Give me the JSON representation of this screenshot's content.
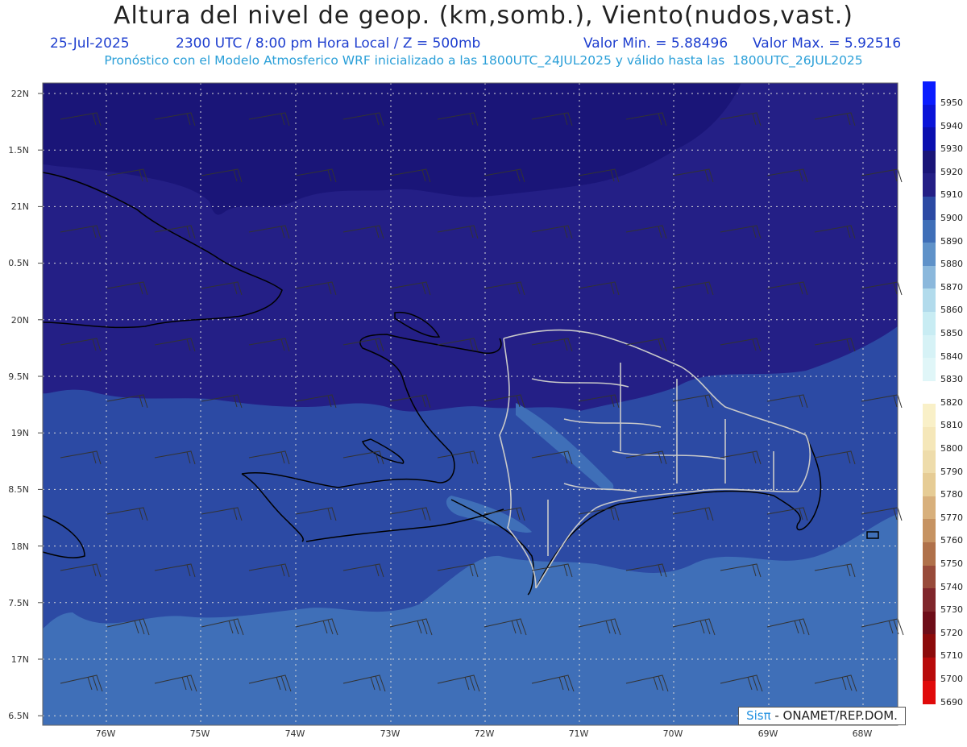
{
  "header": {
    "title": "Altura del nivel de geop. (km,somb.), Viento(nudos,vast.)",
    "date": "25-Jul-2025",
    "time_info": "2300 UTC / 8:00 pm Hora Local / Z = 500mb",
    "min_value": "Valor Min. = 5.88496",
    "max_value": "Valor Max. = 5.92516",
    "model_info": "Pronóstico con el Modelo Atmosferico WRF inicializado a las 1800UTC_24JUL2025 y válido hasta las  1800UTC_26JUL2025"
  },
  "axes": {
    "lat_labels": [
      "22N",
      "1.5N",
      "21N",
      "0.5N",
      "20N",
      "9.5N",
      "19N",
      "8.5N",
      "18N",
      "7.5N",
      "17N",
      "6.5N"
    ],
    "lon_labels": [
      "76W",
      "75W",
      "74W",
      "73W",
      "72W",
      "71W",
      "70W",
      "69W",
      "68W"
    ]
  },
  "legend": {
    "levels": [
      "5950",
      "5940",
      "5930",
      "5920",
      "5910",
      "5900",
      "5890",
      "5880",
      "5870",
      "5860",
      "5850",
      "5840",
      "5830",
      "5820",
      "5810",
      "5800",
      "5790",
      "5780",
      "5770",
      "5760",
      "5750",
      "5740",
      "5730",
      "5720",
      "5710",
      "5700",
      "5690"
    ],
    "colors": [
      "#0a1cff",
      "#0a14d8",
      "#0a0fb0",
      "#1a1578",
      "#241f86",
      "#2c4aa4",
      "#3f6fb8",
      "#5f92c9",
      "#8bb8dc",
      "#b2dbec",
      "#c8ecf3",
      "#d6f2f6",
      "#e0f6f8",
      "#ffffff",
      "#f9f0c8",
      "#f5e7b9",
      "#eedcab",
      "#e6cc95",
      "#d8b07c",
      "#c69362",
      "#b0714a",
      "#984b3a",
      "#80262b",
      "#6e0d18",
      "#8c0a0a",
      "#b80a0a",
      "#e00a0a"
    ]
  },
  "credit": {
    "brand": "Sisπ",
    "text": " - ONAMET/REP.DOM."
  }
}
